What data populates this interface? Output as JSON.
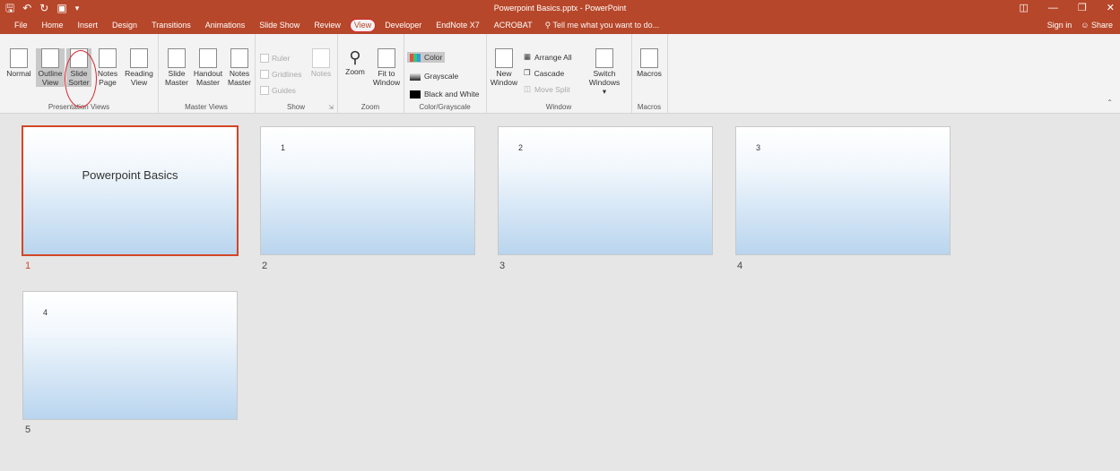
{
  "title_bar": {
    "document_title": "Powerpoint Basics.pptx - PowerPoint",
    "qat_icons": [
      "save-icon",
      "undo-icon",
      "redo-icon",
      "presentation-icon",
      "customize-icon"
    ],
    "window_controls": [
      "ribbon-display-icon",
      "minimize-icon",
      "restore-icon",
      "close-icon"
    ]
  },
  "menu": {
    "tabs": [
      "File",
      "Home",
      "Insert",
      "Design",
      "Transitions",
      "Animations",
      "Slide Show",
      "Review",
      "View",
      "Developer",
      "EndNote X7",
      "ACROBAT"
    ],
    "active_tab": "View",
    "tell_me": "Tell me what you want to do...",
    "sign_in": "Sign in",
    "share": "Share"
  },
  "ribbon": {
    "presentation_views": {
      "label": "Presentation Views",
      "buttons": [
        {
          "l1": "Normal",
          "l2": ""
        },
        {
          "l1": "Outline",
          "l2": "View"
        },
        {
          "l1": "Slide",
          "l2": "Sorter"
        },
        {
          "l1": "Notes",
          "l2": "Page"
        },
        {
          "l1": "Reading",
          "l2": "View"
        }
      ]
    },
    "master_views": {
      "label": "Master Views",
      "buttons": [
        {
          "l1": "Slide",
          "l2": "Master"
        },
        {
          "l1": "Handout",
          "l2": "Master"
        },
        {
          "l1": "Notes",
          "l2": "Master"
        }
      ]
    },
    "show": {
      "label": "Show",
      "checks": [
        "Ruler",
        "Gridlines",
        "Guides"
      ],
      "notes": "Notes"
    },
    "zoom": {
      "label": "Zoom",
      "zoom": "Zoom",
      "fit_l1": "Fit to",
      "fit_l2": "Window"
    },
    "color": {
      "label": "Color/Grayscale",
      "items": [
        "Color",
        "Grayscale",
        "Black and White"
      ]
    },
    "window": {
      "label": "Window",
      "new_l1": "New",
      "new_l2": "Window",
      "arrange": "Arrange All",
      "cascade": "Cascade",
      "move_split": "Move Split",
      "switch_l1": "Switch",
      "switch_l2": "Windows"
    },
    "macros": {
      "label": "Macros",
      "button": "Macros"
    }
  },
  "slides": [
    {
      "number": "1",
      "title": "Powerpoint Basics",
      "inner_number": "",
      "selected": true
    },
    {
      "number": "2",
      "title": "",
      "inner_number": "1",
      "selected": false
    },
    {
      "number": "3",
      "title": "",
      "inner_number": "2",
      "selected": false
    },
    {
      "number": "4",
      "title": "",
      "inner_number": "3",
      "selected": false
    },
    {
      "number": "5",
      "title": "",
      "inner_number": "4",
      "selected": false
    }
  ],
  "colors": {
    "accent": "#b7472a",
    "selection": "#d24726",
    "annotation": "#d9262f"
  }
}
